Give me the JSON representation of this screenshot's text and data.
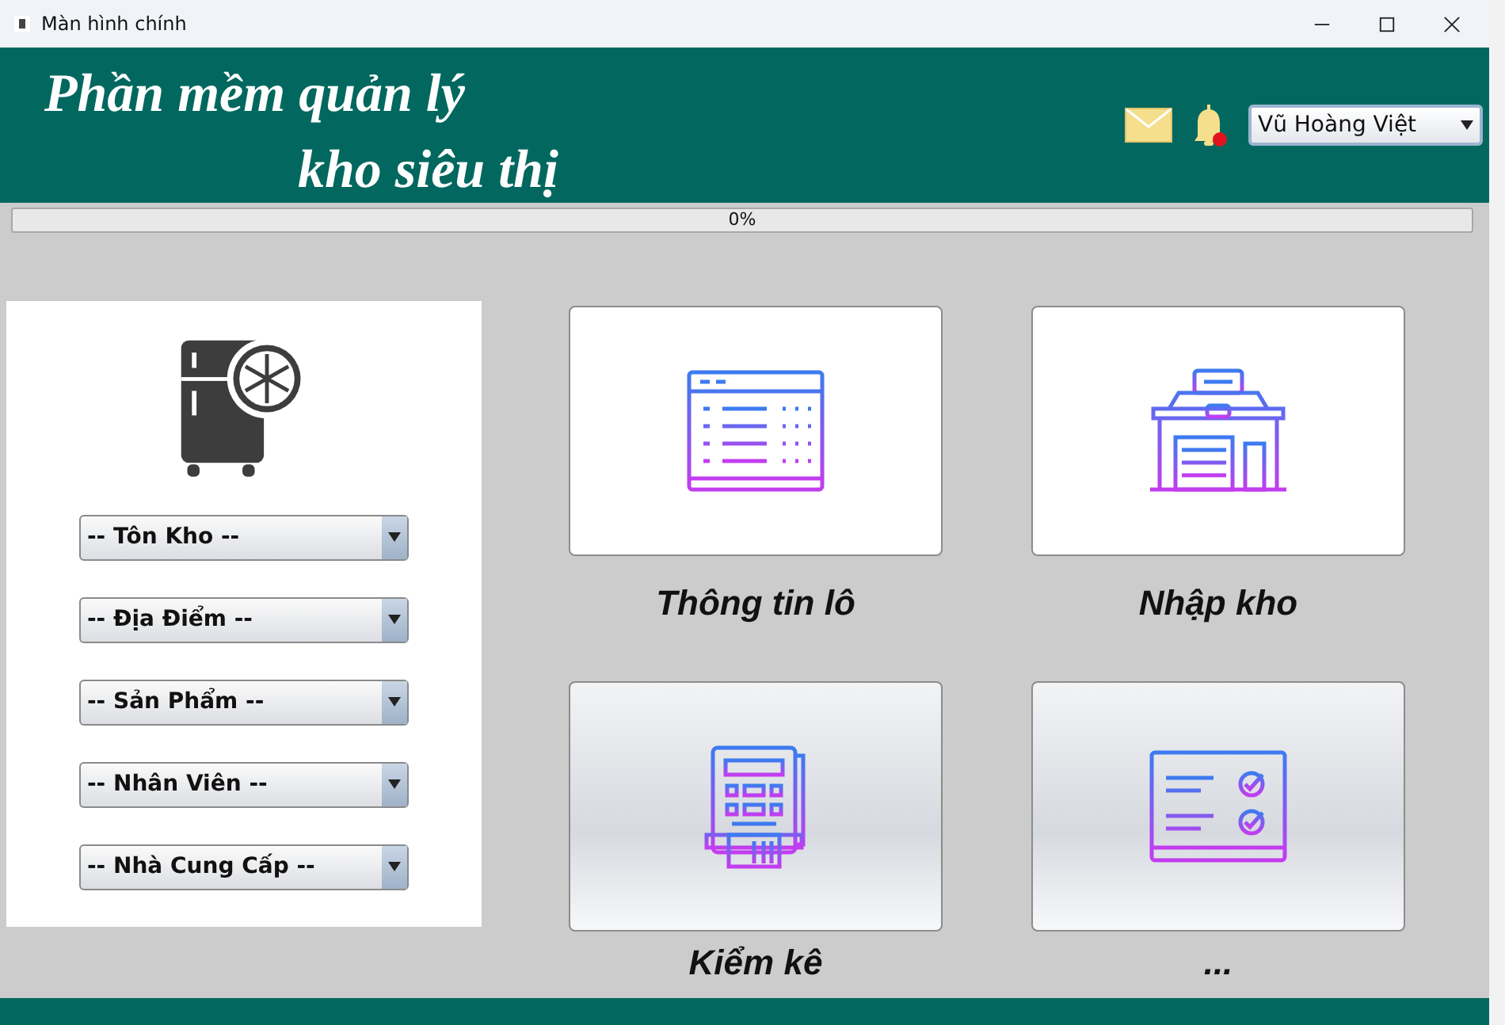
{
  "window": {
    "title": "Màn hình chính"
  },
  "header": {
    "title_lines": [
      "Phần mềm quản lý",
      "kho siêu thị"
    ],
    "notification": true,
    "user": "Vũ Hoàng Việt"
  },
  "progress": {
    "level": 0,
    "reading": "0%"
  },
  "filters": [
    "-- Tôn Kho --",
    "-- Địa Điểm --",
    "-- Sản Phẩm --",
    "-- Nhân Viên --",
    "-- Nhà Cung Cấp --"
  ],
  "tiles": [
    {
      "kind": "table",
      "label": "Thông tin lô",
      "focused": true
    },
    {
      "kind": "store",
      "label": "Nhập kho",
      "focused": true
    },
    {
      "kind": "calculator",
      "label": "Kiểm kê",
      "focused": false
    },
    {
      "kind": "checklist",
      "label": "...",
      "focused": false
    }
  ]
}
